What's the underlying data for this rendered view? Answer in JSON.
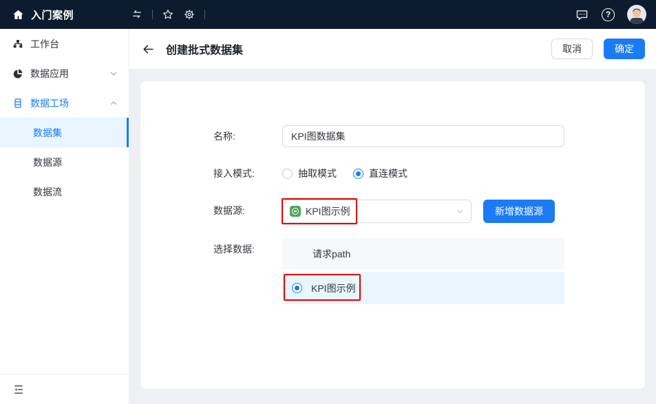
{
  "topbar": {
    "brand": "入门案例"
  },
  "header": {
    "title": "创建批式数据集",
    "cancel": "取消",
    "confirm": "确定"
  },
  "sidebar": {
    "items": [
      {
        "label": "工作台"
      },
      {
        "label": "数据应用"
      },
      {
        "label": "数据工场"
      },
      {
        "label": "数据集"
      },
      {
        "label": "数据源"
      },
      {
        "label": "数据流"
      }
    ]
  },
  "form": {
    "name": {
      "label": "名称:",
      "value": "KPI图数据集"
    },
    "mode": {
      "label": "接入模式:",
      "options": [
        {
          "label": "抽取模式",
          "selected": false
        },
        {
          "label": "直连模式",
          "selected": true
        }
      ]
    },
    "source": {
      "label": "数据源:",
      "selected": "KPI图示例",
      "add_button": "新增数据源"
    },
    "select_data": {
      "label": "选择数据:",
      "column_header": "请求path",
      "rows": [
        {
          "label": "KPI图示例",
          "selected": true
        }
      ]
    }
  },
  "colors": {
    "accent_blue": "#1b7bf5",
    "topbar_bg": "#0d1b2e",
    "annotation_red": "#e60000",
    "selected_row_bg": "#e8f6fe",
    "selected_nav_bg": "#e9f5ff",
    "datasource_icon_green": "#4fa65a"
  }
}
